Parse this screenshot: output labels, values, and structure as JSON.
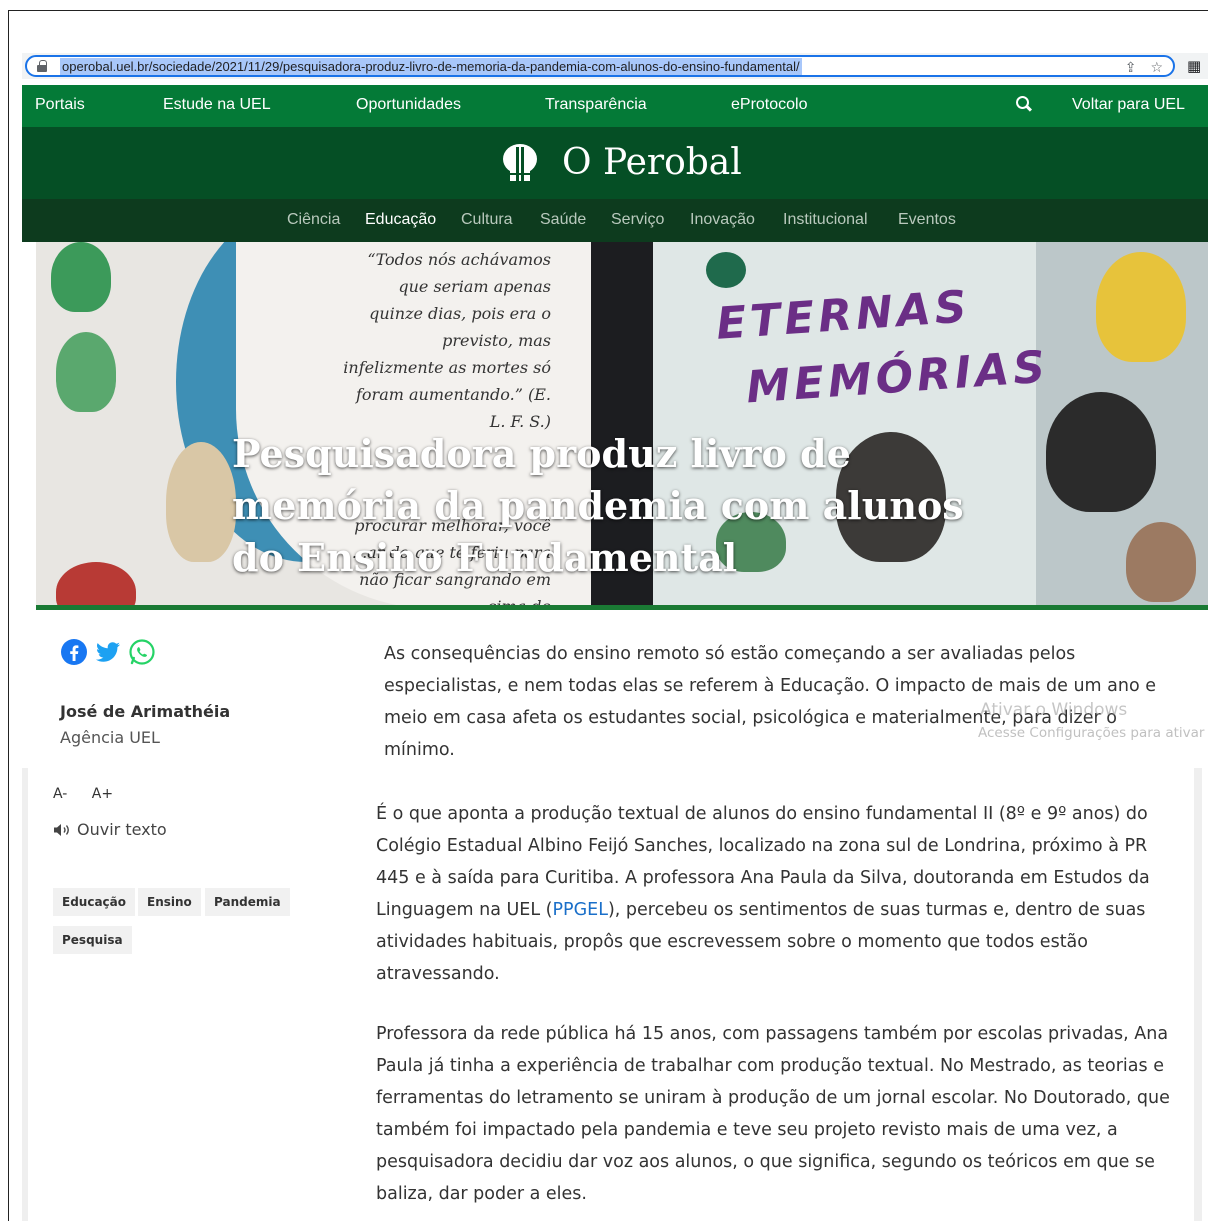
{
  "browser": {
    "url": "operobal.uel.br/sociedade/2021/11/29/pesquisadora-produz-livro-de-memoria-da-pandemia-com-alunos-do-ensino-fundamental/"
  },
  "topnav": {
    "items": [
      "Portais",
      "Estude na UEL",
      "Oportunidades",
      "Transparência",
      "eProtocolo"
    ],
    "back_label": "Voltar para UEL"
  },
  "brand": {
    "name": "O Perobal"
  },
  "categories": {
    "items": [
      "Ciência",
      "Educação",
      "Cultura",
      "Saúde",
      "Serviço",
      "Inovação",
      "Institucional",
      "Eventos"
    ],
    "active": "Educação"
  },
  "hero": {
    "quote_top": "“Todos nós achávamos que seriam apenas quinze dias, pois era o previsto, mas infelizmente as mortes só foram aumentando.” (E. L. F. S.)",
    "quote_bottom": "procurar melhorar, você ...ar do que te feriu para não ficar sangrando em cima de",
    "cover_title_line1": "ETERNAS",
    "cover_title_line2": "MEMÓRIAS",
    "headline": "Pesquisadora produz livro de memória da pandemia com alunos do Ensino Fundamental"
  },
  "sidebar": {
    "author": "José de Arimathéia",
    "agency": "Agência UEL",
    "font_decrease": "A-",
    "font_increase": "A+",
    "listen_label": "Ouvir texto",
    "tags": [
      "Educação",
      "Ensino",
      "Pandemia",
      "Pesquisa"
    ]
  },
  "article": {
    "p1": "As consequências do ensino remoto só estão começando a ser avaliadas pelos especialistas, e nem todas elas se referem à Educação. O impacto de mais de um ano e meio em casa afeta os estudantes social, psicológica e materialmente, para dizer o mínimo.",
    "p2_before": "É o que aponta a produção textual de alunos do ensino fundamental II (8º e 9º anos) do Colégio Estadual Albino Feijó Sanches, localizado na zona sul de Londrina, próximo à PR 445 e à saída para Curitiba. A professora Ana Paula da Silva, doutoranda em Estudos da Linguagem na UEL (",
    "p2_link": "PPGEL",
    "p2_after": "), percebeu os sentimentos de suas turmas e, dentro de suas atividades habituais, propôs que escrevessem sobre o momento que todos estão atravessando.",
    "p3": "Professora da rede pública há 15 anos, com passagens também por escolas privadas, Ana Paula já tinha a experiência de trabalhar com produção textual. No Mestrado, as teorias e ferramentas do letramento se uniram à produção de um jornal escolar. No Doutorado, que também foi impactado pela pandemia e teve seu projeto revisto mais de uma vez, a pesquisadora decidiu dar voz aos alunos, o que significa, segundo os teóricos em que se baliza, dar poder a eles."
  },
  "os_watermark": {
    "line1": "Ativar o Windows",
    "line2": "Acesse Configurações para ativar"
  },
  "colors": {
    "nav_green": "#047a37",
    "brand_green": "#054f25",
    "category_green": "#0d3b1e",
    "link_blue": "#1a6fc9",
    "cover_purple": "#6b2e86"
  }
}
